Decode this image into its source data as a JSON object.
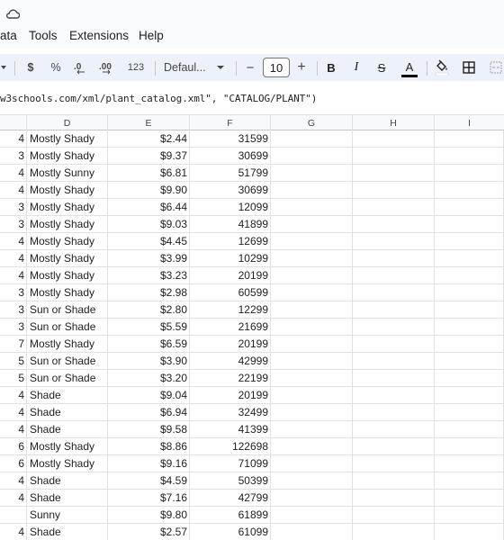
{
  "menu": [
    "ata",
    "Tools",
    "Extensions",
    "Help"
  ],
  "toolbar": {
    "currency": "$",
    "percent": "%",
    "dec_decrease": ".0←",
    "dec_increase": ".00",
    "number_format": "123",
    "font_name": "Defaul...",
    "font_size": "10",
    "minus": "−",
    "plus": "+",
    "bold": "B",
    "italic": "I",
    "strike": "S",
    "text_color": "A"
  },
  "formula": "w3schools.com/xml/plant_catalog.xml\", \"CATALOG/PLANT\")",
  "columns": [
    "D",
    "E",
    "F",
    "G",
    "H",
    "I"
  ],
  "rows": [
    {
      "c": "4",
      "d": "Mostly Shady",
      "e": "$2.44",
      "f": "31599"
    },
    {
      "c": "3",
      "d": "Mostly Shady",
      "e": "$9.37",
      "f": "30699"
    },
    {
      "c": "4",
      "d": "Mostly Sunny",
      "e": "$6.81",
      "f": "51799"
    },
    {
      "c": "4",
      "d": "Mostly Shady",
      "e": "$9.90",
      "f": "30699"
    },
    {
      "c": "3",
      "d": "Mostly Shady",
      "e": "$6.44",
      "f": "12099"
    },
    {
      "c": "3",
      "d": "Mostly Shady",
      "e": "$9.03",
      "f": "41899"
    },
    {
      "c": "4",
      "d": "Mostly Shady",
      "e": "$4.45",
      "f": "12699"
    },
    {
      "c": "4",
      "d": "Mostly Shady",
      "e": "$3.99",
      "f": "10299"
    },
    {
      "c": "4",
      "d": "Mostly Shady",
      "e": "$3.23",
      "f": "20199"
    },
    {
      "c": "3",
      "d": "Mostly Shady",
      "e": "$2.98",
      "f": "60599"
    },
    {
      "c": "3",
      "d": "Sun or Shade",
      "e": "$2.80",
      "f": "12299"
    },
    {
      "c": "3",
      "d": "Sun or Shade",
      "e": "$5.59",
      "f": "21699"
    },
    {
      "c": "7",
      "d": "Mostly Shady",
      "e": "$6.59",
      "f": "20199"
    },
    {
      "c": "5",
      "d": "Sun or Shade",
      "e": "$3.90",
      "f": "42999"
    },
    {
      "c": "5",
      "d": "Sun or Shade",
      "e": "$3.20",
      "f": "22199"
    },
    {
      "c": "4",
      "d": "Shade",
      "e": "$9.04",
      "f": "20199"
    },
    {
      "c": "4",
      "d": "Shade",
      "e": "$6.94",
      "f": "32499"
    },
    {
      "c": "4",
      "d": "Shade",
      "e": "$9.58",
      "f": "41399"
    },
    {
      "c": "6",
      "d": "Mostly Shady",
      "e": "$8.86",
      "f": "122698"
    },
    {
      "c": "6",
      "d": "Mostly Shady",
      "e": "$9.16",
      "f": "71099"
    },
    {
      "c": "4",
      "d": "Shade",
      "e": "$4.59",
      "f": "50399"
    },
    {
      "c": "4",
      "d": "Shade",
      "e": "$7.16",
      "f": "42799"
    },
    {
      "c": "",
      "d": "Sunny",
      "e": "$9.80",
      "f": "61899"
    },
    {
      "c": "4",
      "d": "Shade",
      "e": "$2.57",
      "f": "61099"
    }
  ]
}
